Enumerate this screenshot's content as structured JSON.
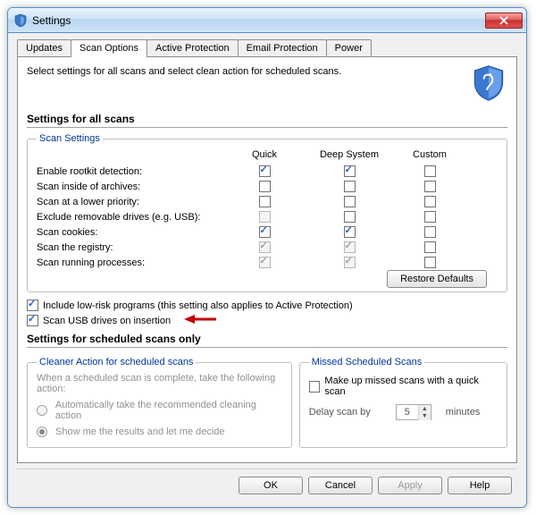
{
  "window": {
    "title": "Settings"
  },
  "tabs": [
    {
      "label": "Updates"
    },
    {
      "label": "Scan Options"
    },
    {
      "label": "Active Protection"
    },
    {
      "label": "Email Protection"
    },
    {
      "label": "Power"
    }
  ],
  "intro": "Select settings for all scans and select clean action for scheduled scans.",
  "sections": {
    "all_scans": "Settings for all scans",
    "scheduled": "Settings for scheduled scans only"
  },
  "scan_settings": {
    "legend": "Scan Settings",
    "cols": {
      "quick": "Quick",
      "deep": "Deep System",
      "custom": "Custom"
    },
    "rows": [
      {
        "label": "Enable rootkit detection:",
        "quick": true,
        "deep": true,
        "custom": false,
        "quickDisabled": false,
        "deepDisabled": false,
        "customDisabled": false
      },
      {
        "label": "Scan inside of archives:",
        "quick": false,
        "deep": false,
        "custom": false,
        "quickDisabled": false,
        "deepDisabled": false,
        "customDisabled": false
      },
      {
        "label": "Scan at a lower priority:",
        "quick": false,
        "deep": false,
        "custom": false,
        "quickDisabled": false,
        "deepDisabled": false,
        "customDisabled": false
      },
      {
        "label": "Exclude removable drives (e.g. USB):",
        "quick": false,
        "deep": false,
        "custom": false,
        "quickDisabled": true,
        "deepDisabled": false,
        "customDisabled": false
      },
      {
        "label": "Scan cookies:",
        "quick": true,
        "deep": true,
        "custom": false,
        "quickDisabled": false,
        "deepDisabled": false,
        "customDisabled": false
      },
      {
        "label": "Scan the registry:",
        "quick": true,
        "deep": true,
        "custom": false,
        "quickDisabled": true,
        "deepDisabled": true,
        "customDisabled": false
      },
      {
        "label": "Scan running processes:",
        "quick": true,
        "deep": true,
        "custom": false,
        "quickDisabled": true,
        "deepDisabled": true,
        "customDisabled": false
      }
    ],
    "restore": "Restore Defaults"
  },
  "global_checks": {
    "lowrisk": {
      "label": "Include low-risk programs (this setting also applies to Active Protection)",
      "checked": true
    },
    "usb": {
      "label": "Scan USB drives on insertion",
      "checked": true
    }
  },
  "cleaner": {
    "legend": "Cleaner Action for scheduled scans",
    "desc": "When a scheduled scan is complete, take the following action:",
    "opt1": "Automatically take the recommended cleaning action",
    "opt2": "Show me the results and let me decide"
  },
  "missed": {
    "legend": "Missed Scheduled Scans",
    "chk": "Make up missed scans with a quick scan",
    "delay_pre": "Delay scan by",
    "delay_val": "5",
    "delay_post": "minutes"
  },
  "buttons": {
    "ok": "OK",
    "cancel": "Cancel",
    "apply": "Apply",
    "help": "Help"
  }
}
